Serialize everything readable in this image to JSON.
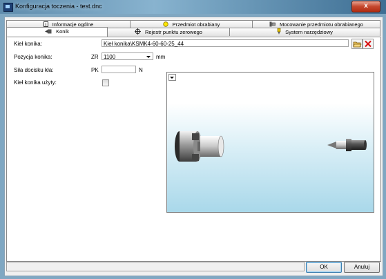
{
  "window": {
    "title": "Konfiguracja toczenia - test.dnc",
    "close_glyph": "x"
  },
  "tabs_row1": [
    {
      "label": "Informacje ogólne",
      "icon": "document-info-icon"
    },
    {
      "label": "Przedmiot obrabiany",
      "icon": "yellow-circle-icon"
    },
    {
      "label": "Mocowanie przedmiotu obrabianego",
      "icon": "chuck-icon"
    }
  ],
  "tabs_row2": [
    {
      "label": "Konik",
      "icon": "tailstock-icon",
      "active": true
    },
    {
      "label": "Rejestr punktu zerowego",
      "icon": "crosshair-icon"
    },
    {
      "label": "System narzędziowy",
      "icon": "tool-icon"
    }
  ],
  "form": {
    "tailstock_center": {
      "label": "Kieł konika:",
      "value": "Kieł konika\\KSMK4-60-60-25_44"
    },
    "tailstock_position": {
      "label": "Pozycja konika:",
      "code": "ZR",
      "value": "1100",
      "unit": "mm"
    },
    "clamping_force": {
      "label": "Siła docisku kła:",
      "code": "PK",
      "value": "",
      "unit": "N"
    },
    "tailstock_used": {
      "label": "Kieł konika użyty:",
      "checked": false
    }
  },
  "buttons": {
    "ok": "OK",
    "cancel": "Anuluj"
  },
  "colors": {
    "titlebar": "#6e9cbb",
    "close": "#c5472d",
    "preview_bottom": "#a9d8ea"
  }
}
